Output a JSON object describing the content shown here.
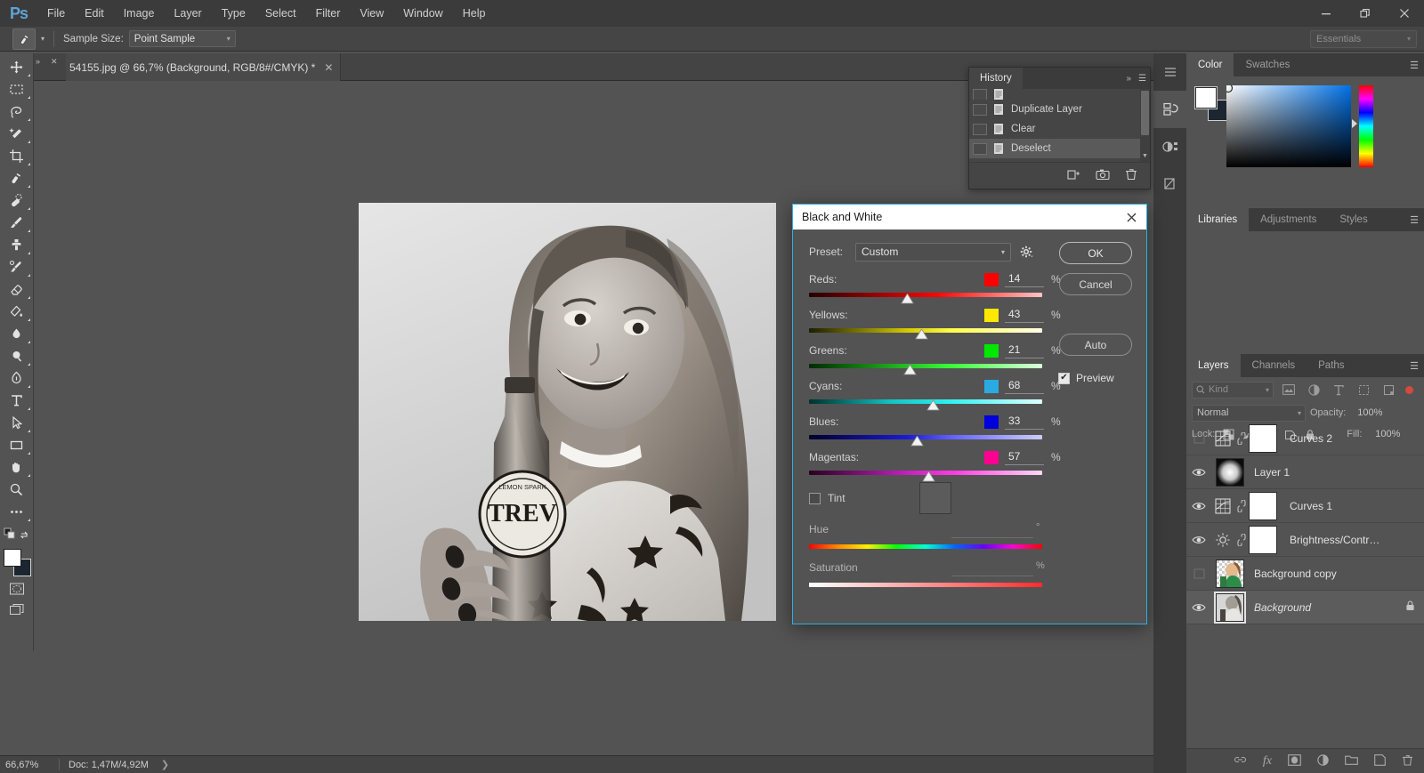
{
  "app": {
    "logo": "Ps",
    "menus": [
      "File",
      "Edit",
      "Image",
      "Layer",
      "Type",
      "Select",
      "Filter",
      "View",
      "Window",
      "Help"
    ],
    "window_controls": {
      "minimize": "—",
      "restore": "❐",
      "close": "✕"
    }
  },
  "options_bar": {
    "sample_size_label": "Sample Size:",
    "sample_size_value": "Point Sample",
    "workspace": "Essentials"
  },
  "document_tab": {
    "title": "54155.jpg @ 66,7% (Background, RGB/8#/CMYK) *",
    "close": "✕"
  },
  "status_bar": {
    "zoom": "66,67%",
    "doc_label": "Doc:",
    "doc_value": "1,47M/4,92M",
    "arrow": "❯"
  },
  "toolbar": {
    "tools": [
      {
        "name": "move-tool"
      },
      {
        "name": "rectangular-marquee-tool"
      },
      {
        "name": "lasso-tool"
      },
      {
        "name": "quick-selection-tool"
      },
      {
        "name": "crop-tool"
      },
      {
        "name": "eyedropper-tool"
      },
      {
        "name": "spot-healing-brush-tool"
      },
      {
        "name": "brush-tool"
      },
      {
        "name": "clone-stamp-tool"
      },
      {
        "name": "history-brush-tool"
      },
      {
        "name": "eraser-tool"
      },
      {
        "name": "gradient-tool"
      },
      {
        "name": "blur-tool"
      },
      {
        "name": "dodge-tool"
      },
      {
        "name": "pen-tool"
      },
      {
        "name": "horizontal-type-tool"
      },
      {
        "name": "path-selection-tool"
      },
      {
        "name": "rectangle-tool"
      },
      {
        "name": "hand-tool"
      },
      {
        "name": "zoom-tool"
      },
      {
        "name": "edit-toolbar-tool"
      }
    ],
    "foreground_color": "#ffffff",
    "background_color": "#1c2630"
  },
  "history_panel": {
    "tab": "History",
    "items": [
      {
        "label": "",
        "clipped": true
      },
      {
        "label": "Duplicate Layer",
        "selected": false
      },
      {
        "label": "Clear",
        "selected": false
      },
      {
        "label": "Deselect",
        "selected": true
      }
    ],
    "footer_icons": [
      "new-document-from-state-icon",
      "create-snapshot-icon",
      "delete-state-icon"
    ],
    "collapse_icon": "»",
    "menu_icon": "☰"
  },
  "color_panel": {
    "tabs": [
      {
        "label": "Color",
        "active": true
      },
      {
        "label": "Swatches",
        "active": false
      }
    ],
    "foreground_color": "#ffffff",
    "background_color": "#1c2630",
    "menu_icon": "☰"
  },
  "libraries_panel": {
    "tabs": [
      {
        "label": "Libraries",
        "active": true
      },
      {
        "label": "Adjustments",
        "active": false
      },
      {
        "label": "Styles",
        "active": false
      }
    ],
    "menu_icon": "☰"
  },
  "layers_panel": {
    "tabs": [
      {
        "label": "Layers",
        "active": true
      },
      {
        "label": "Channels",
        "active": false
      },
      {
        "label": "Paths",
        "active": false
      }
    ],
    "menu_icon": "☰",
    "filter_kind": "Kind",
    "blend_mode": "Normal",
    "opacity_label": "Opacity:",
    "opacity_value": "100%",
    "lock_label": "Lock:",
    "fill_label": "Fill:",
    "fill_value": "100%",
    "layers": [
      {
        "name": "Curves 2",
        "visible": false,
        "type": "curves-adjustment",
        "selected": false,
        "locked": false
      },
      {
        "name": "Layer 1",
        "visible": true,
        "type": "pixel-radial",
        "selected": false,
        "locked": false
      },
      {
        "name": "Curves 1",
        "visible": true,
        "type": "curves-adjustment",
        "selected": false,
        "locked": false
      },
      {
        "name": "Brightness/Contr…",
        "visible": true,
        "type": "brightness-adjustment",
        "selected": false,
        "locked": false
      },
      {
        "name": "Background copy",
        "visible": false,
        "type": "photo-color",
        "selected": false,
        "locked": false
      },
      {
        "name": "Background",
        "visible": true,
        "type": "photo-bw",
        "selected": true,
        "locked": true,
        "italic": true
      }
    ],
    "footer_icons": [
      "link-layers-icon",
      "add-layer-style-icon",
      "add-layer-mask-icon",
      "new-adjustment-layer-icon",
      "new-group-icon",
      "new-layer-icon",
      "delete-layer-icon"
    ]
  },
  "bw_dialog": {
    "title": "Black and White",
    "close_icon": "✕",
    "preset_label": "Preset:",
    "preset_value": "Custom",
    "gear_icon": "gear-icon",
    "percent_sign": "%",
    "sliders": [
      {
        "name": "Reds:",
        "value": "14",
        "chip": "#ff0000",
        "pos": 42,
        "track": "linear-gradient(to right,#240000,#ff0505,#ffc4c4)"
      },
      {
        "name": "Yellows:",
        "value": "43",
        "chip": "#ffe800",
        "pos": 48,
        "track": "linear-gradient(to right,#1d1d00,#d4c800,#ffff55,#ffffe0)"
      },
      {
        "name": "Greens:",
        "value": "21",
        "chip": "#00e800",
        "pos": 43,
        "track": "linear-gradient(to right,#002a00,#1fbf1f,#3cff3c,#d8ffd8)"
      },
      {
        "name": "Cyans:",
        "value": "68",
        "chip": "#29abe2",
        "pos": 53,
        "track": "linear-gradient(to right,#00302c,#16c5c5,#2ef0ef,#dcffff)"
      },
      {
        "name": "Blues:",
        "value": "33",
        "chip": "#0000dd",
        "pos": 46,
        "track": "linear-gradient(to right,#00002c,#1414d0,#5b5bff,#c9c9ff)"
      },
      {
        "name": "Magentas:",
        "value": "57",
        "chip": "#ff0090",
        "pos": 51,
        "track": "linear-gradient(to right,#290021,#b81eb8,#ff3ce0,#ffd4f4)"
      }
    ],
    "tint_label": "Tint",
    "tint_checked": false,
    "hue_label": "Hue",
    "hue_unit": "°",
    "saturation_label": "Saturation",
    "saturation_unit": "%",
    "buttons": {
      "ok": "OK",
      "cancel": "Cancel",
      "auto": "Auto"
    },
    "preview_label": "Preview",
    "preview_checked": true,
    "preview_check_glyph": "✔",
    "accent_color": "#2bb0e8"
  }
}
